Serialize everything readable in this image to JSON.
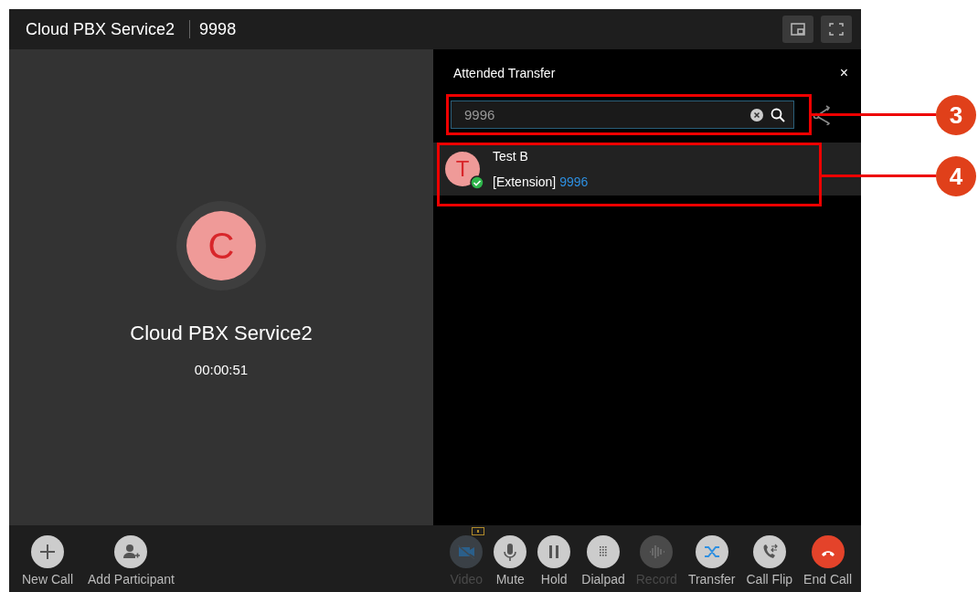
{
  "window": {
    "title": "Cloud PBX Service2",
    "number": "9998"
  },
  "call": {
    "avatar_letter": "C",
    "name": "Cloud PBX Service2",
    "duration": "00:00:51"
  },
  "transfer_panel": {
    "title": "Attended Transfer",
    "close": "×",
    "search": {
      "value": "9996"
    },
    "results": [
      {
        "avatar_letter": "T",
        "name": "Test B",
        "type": "[Extension]",
        "number": "9996",
        "online": true
      }
    ]
  },
  "left_actions": [
    {
      "kind": "new-call",
      "label": "New Call",
      "disabled": false
    },
    {
      "kind": "add-participant",
      "label": "Add Participant",
      "disabled": false
    }
  ],
  "call_actions": [
    {
      "kind": "video",
      "label": "Video",
      "disabled": true
    },
    {
      "kind": "mute",
      "label": "Mute",
      "disabled": false
    },
    {
      "kind": "hold",
      "label": "Hold",
      "disabled": false
    },
    {
      "kind": "dialpad",
      "label": "Dialpad",
      "disabled": false
    },
    {
      "kind": "record",
      "label": "Record",
      "disabled": true
    },
    {
      "kind": "transfer",
      "label": "Transfer",
      "disabled": false
    },
    {
      "kind": "flip",
      "label": "Call Flip",
      "disabled": false
    },
    {
      "kind": "hangup",
      "label": "End Call",
      "disabled": false
    }
  ],
  "callouts": [
    {
      "label": "3"
    },
    {
      "label": "4"
    }
  ]
}
